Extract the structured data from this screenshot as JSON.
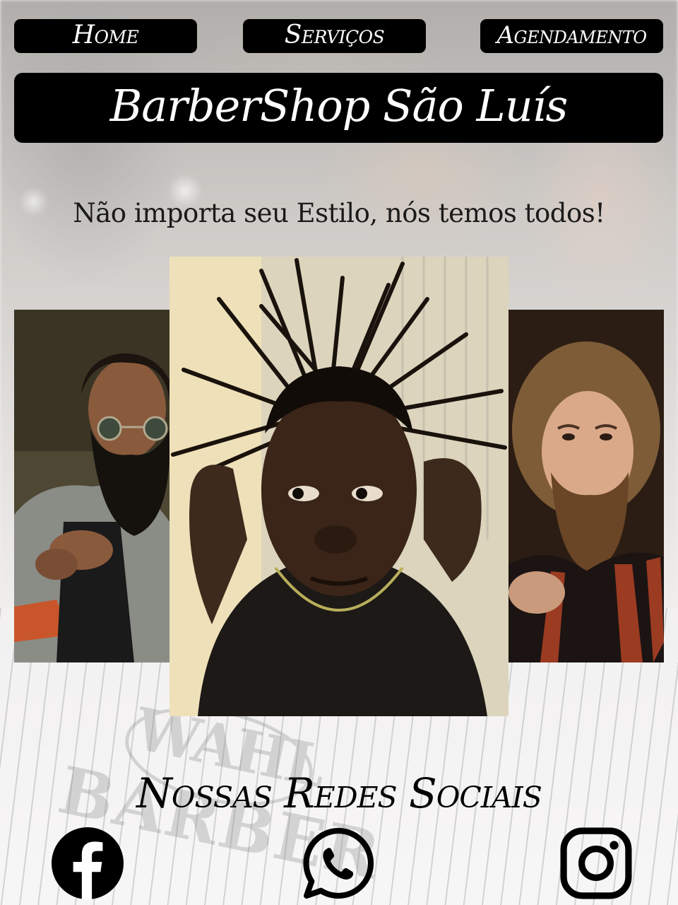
{
  "nav": {
    "home": "Home",
    "servicos": "Serviços",
    "agendamento": "Agendamento"
  },
  "header": {
    "title": "BarberShop São Luís"
  },
  "slogan": "Não importa seu Estilo, nós temos todos!",
  "social": {
    "title": "Nossas Redes Sociais",
    "items": [
      {
        "icon": "facebook-icon"
      },
      {
        "icon": "whatsapp-icon"
      },
      {
        "icon": "instagram-icon"
      }
    ]
  },
  "background_watermark": [
    "WAHL",
    "BARBER"
  ],
  "colors": {
    "nav_background": "#000000",
    "nav_text": "#ffffff",
    "body_text": "#1a1a1a"
  }
}
